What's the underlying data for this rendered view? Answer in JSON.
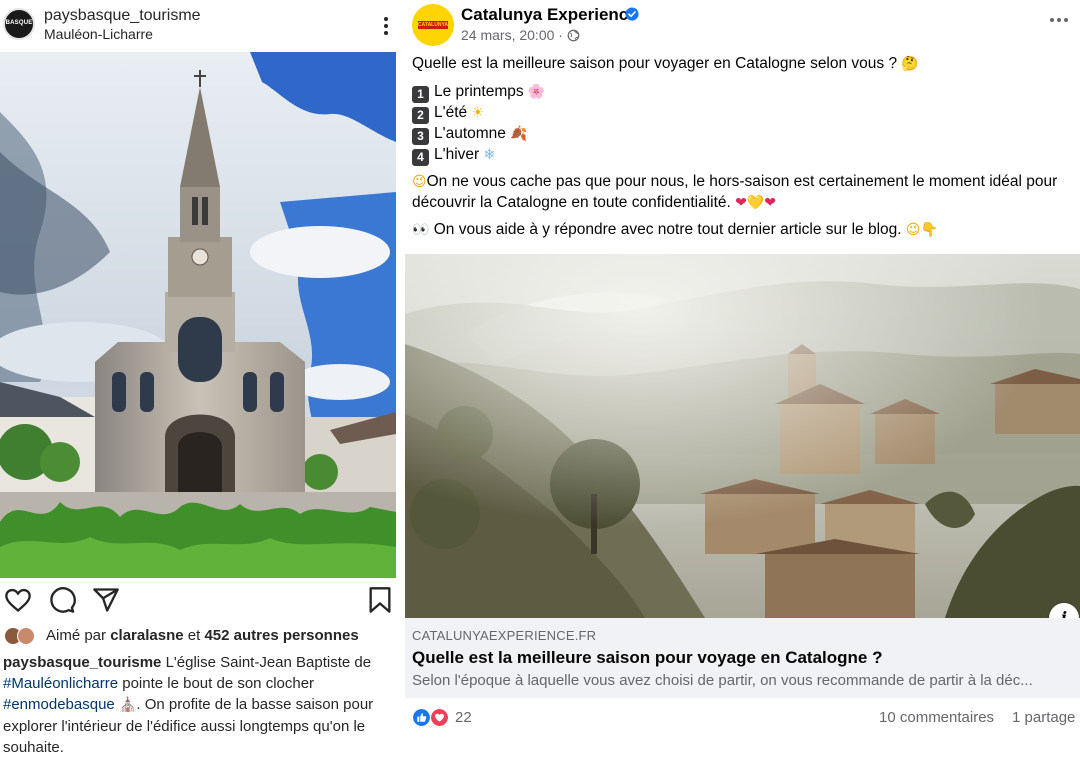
{
  "instagram": {
    "avatar_text": "BASQUE",
    "username": "paysbasque_tourisme",
    "location": "Mauléon-Licharre",
    "likes": {
      "prefix": "Aimé par ",
      "user": "claralasne",
      "middle": " et ",
      "others": "452 autres personnes"
    },
    "caption": {
      "user": "paysbasque_tourisme",
      "text1": " L'église Saint-Jean Baptiste de ",
      "tag1": "#Mauléonlicharre",
      "text2": " pointe le bout de son clocher ",
      "tag2": "#enmodebasque",
      "emoji": "⛪",
      "text3": ". On profite de la basse saison pour explorer l'intérieur de l'édifice aussi longtemps qu'on le souhaite."
    }
  },
  "facebook": {
    "logo_text": "CATALUNYA",
    "page_name": "Catalunya Experience",
    "date": "24 mars, 20:00 ·",
    "question": "Quelle est la meilleure saison pour voyager en Catalogne selon vous ? ",
    "question_emoji": "🤔",
    "options": [
      {
        "num": "1",
        "label": "Le printemps ",
        "emoji": "🌸"
      },
      {
        "num": "2",
        "label": "L'été ",
        "emoji": "☀"
      },
      {
        "num": "3",
        "label": "L'automne ",
        "emoji": "🍂"
      },
      {
        "num": "4",
        "label": "L'hiver ",
        "emoji": "❄"
      }
    ],
    "para2_emoji": "😉",
    "para2": "On ne vous cache pas que pour nous, le hors-saison est certainement le moment idéal pour découvrir la Catalogne en toute confidentialité. ",
    "para2_hearts": "❤💛❤",
    "para3_emoji": "👀",
    "para3": " On vous aide à y répondre avec notre tout dernier article sur le blog. ",
    "para3_end": "😉👇",
    "info_icon": "i",
    "link": {
      "domain": "CATALUNYAEXPERIENCE.FR",
      "title": "Quelle est la meilleure saison pour voyage en Catalogne ?",
      "description": "Selon l'époque à laquelle vous avez choisi de partir, on vous recommande de partir à la déc..."
    },
    "reactions_count": "22",
    "comments": "10 commentaires",
    "shares": "1 partage",
    "colors": {
      "like": "#1877f2",
      "love": "#f33e58",
      "logo": "#ffd400"
    }
  }
}
